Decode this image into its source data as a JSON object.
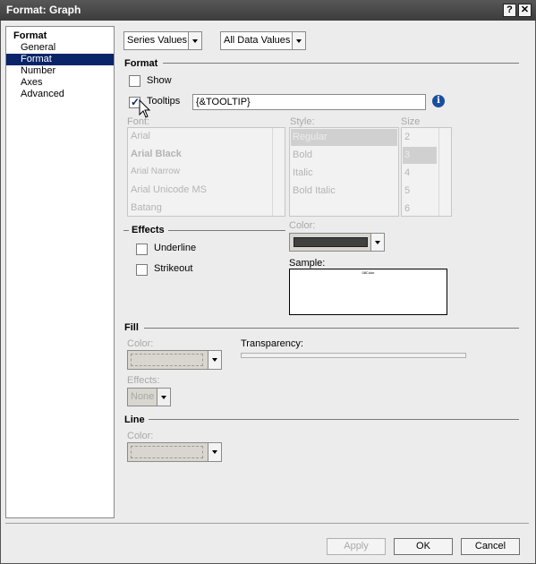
{
  "window": {
    "title": "Format: Graph",
    "help_label": "?",
    "close_label": "✕"
  },
  "nav": {
    "header": "Format",
    "items": [
      {
        "label": "General",
        "selected": false
      },
      {
        "label": "Format",
        "selected": true
      },
      {
        "label": "Number",
        "selected": false
      },
      {
        "label": "Axes",
        "selected": false
      },
      {
        "label": "Advanced",
        "selected": false
      }
    ]
  },
  "toolbar": {
    "series_select": "Series Values",
    "data_select": "All Data Values"
  },
  "format_section": {
    "title": "Format",
    "show_label": "Show",
    "show_checked": false,
    "tooltips_label": "Tooltips",
    "tooltips_checked": true,
    "tooltip_value": "{&TOOLTIP}",
    "info_icon": "i"
  },
  "font": {
    "label": "Font:",
    "items": [
      "Arial",
      "Arial Black",
      "Arial Narrow",
      "Arial Unicode MS",
      "Batang"
    ],
    "style_label": "Style:",
    "styles": [
      "Regular",
      "Bold",
      "Italic",
      "Bold Italic"
    ],
    "size_label": "Size",
    "sizes": [
      "2",
      "3",
      "4",
      "5",
      "6"
    ]
  },
  "effects": {
    "title": "Effects",
    "underline_label": "Underline",
    "strikeout_label": "Strikeout",
    "color_label": "Color:",
    "color_value": "#404040",
    "sample_label": "Sample:",
    "sample_text": "08Color"
  },
  "fill": {
    "title": "Fill",
    "color_label": "Color:",
    "transparency_label": "Transparency:",
    "effects_label": "Effects:",
    "effects_value": "None"
  },
  "line": {
    "title": "Line",
    "color_label": "Color:"
  },
  "footer": {
    "apply": "Apply",
    "ok": "OK",
    "cancel": "Cancel"
  }
}
